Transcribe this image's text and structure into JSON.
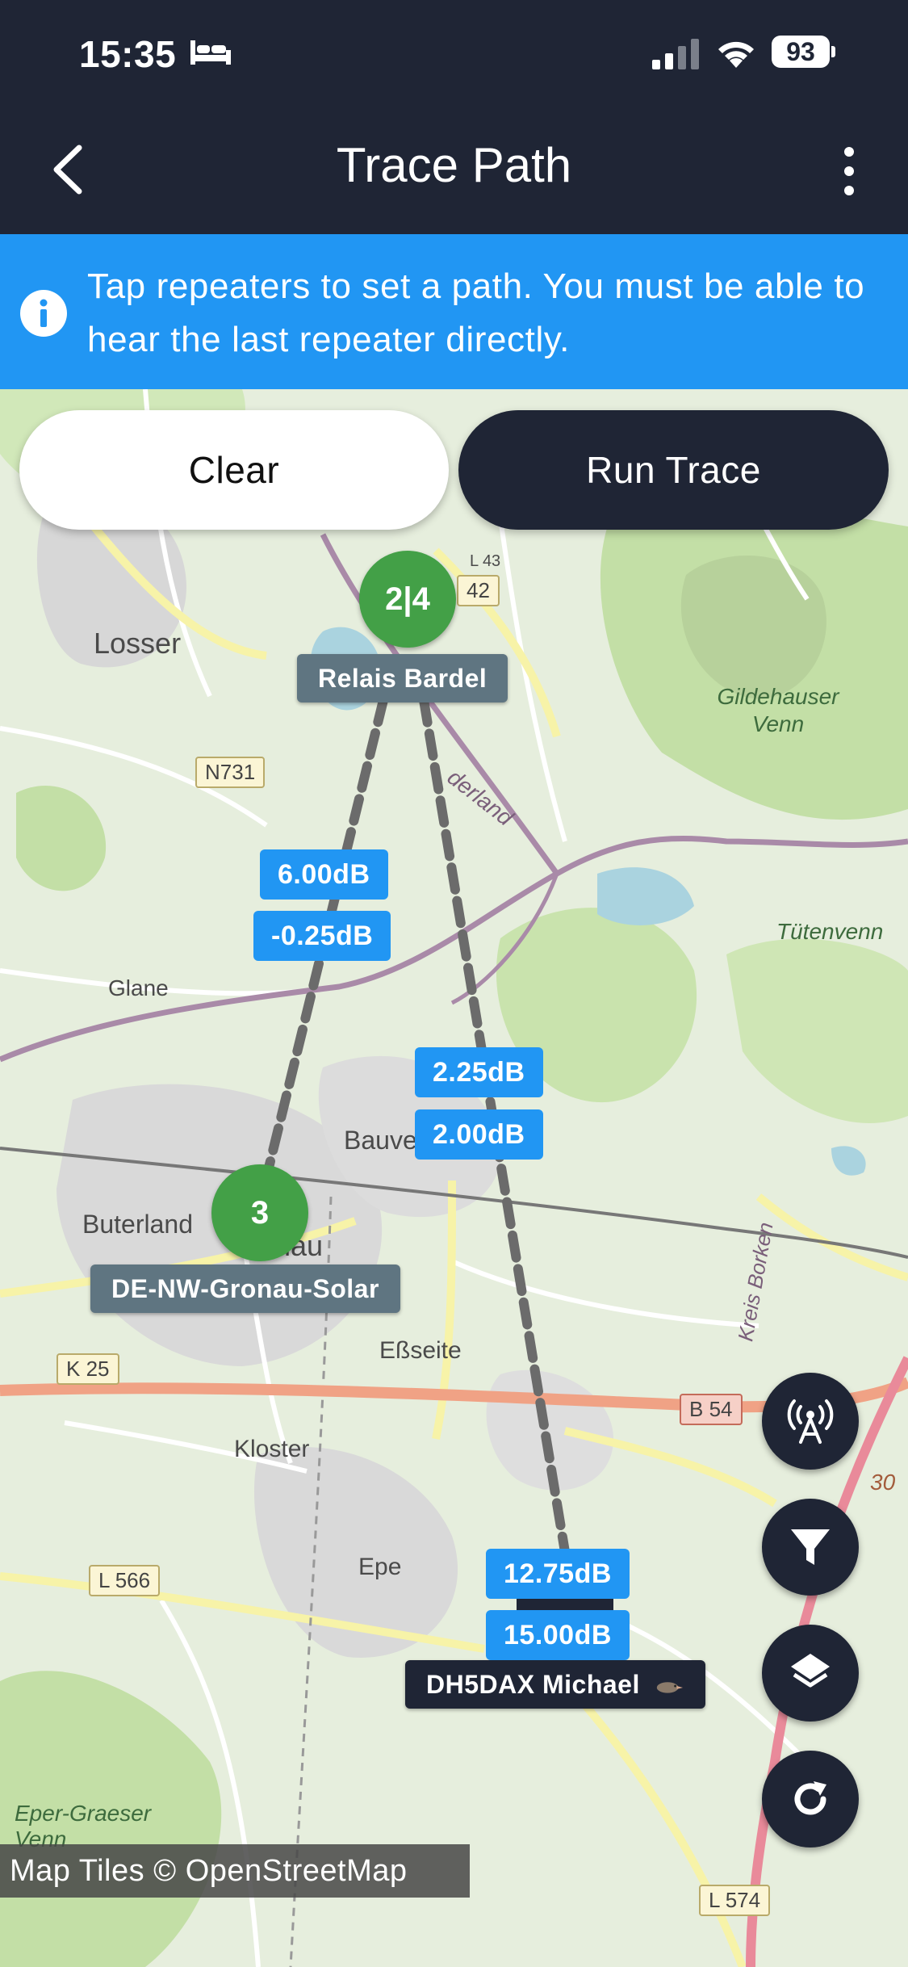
{
  "status_bar": {
    "time": "15:35",
    "battery": "93"
  },
  "app_bar": {
    "title": "Trace Path"
  },
  "info_banner": {
    "text": "Tap repeaters to set a path. You must be able to hear the last repeater directly."
  },
  "actions": {
    "clear_label": "Clear",
    "run_label": "Run Trace"
  },
  "map": {
    "places": [
      "Losser",
      "N731",
      "Gildehauser Venn",
      "Tütenvenn",
      "Glane",
      "Bauve",
      "Buterland",
      "nau",
      "Eßseite",
      "K 25",
      "B 54",
      "Kloster",
      "Epe",
      "L 566",
      "Eper-Graeser Venn",
      "L 574",
      "42",
      "L 43",
      "derland",
      "Kreis Borken",
      "30"
    ],
    "attribution": "Map Tiles © OpenStreetMap"
  },
  "nodes": [
    {
      "badge": "2|4",
      "label": "Relais Bardel"
    },
    {
      "badge": "3",
      "label": "DE-NW-Gronau-Solar"
    },
    {
      "badge": "",
      "label": "DH5DAX Michael"
    }
  ],
  "snr_labels": {
    "left_upper": "6.00dB",
    "left_lower": "-0.25dB",
    "mid_upper": "2.25dB",
    "mid_lower": "2.00dB",
    "bottom_upper": "12.75dB",
    "bottom_lower": "15.00dB"
  },
  "fabs": [
    "antenna-icon",
    "filter-icon",
    "layers-icon",
    "refresh-icon"
  ]
}
